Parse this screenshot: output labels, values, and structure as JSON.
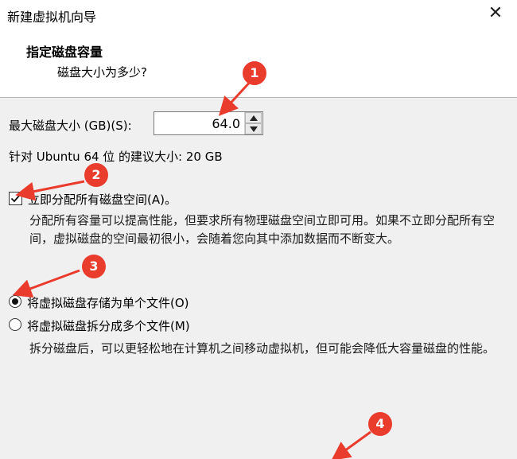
{
  "window": {
    "title": "新建虚拟机向导"
  },
  "header": {
    "title": "指定磁盘容量",
    "subtitle": "磁盘大小为多少?"
  },
  "disk_size": {
    "label": "最大磁盘大小 (GB)(S):",
    "value": "64.0",
    "recommend": "针对 Ubuntu 64 位 的建议大小: 20 GB"
  },
  "allocate": {
    "label": "立即分配所有磁盘空间(A)。",
    "checked": true,
    "description": "分配所有容量可以提高性能，但要求所有物理磁盘空间立即可用。如果不立即分配所有空间，虚拟磁盘的空间最初很小，会随着您向其中添加数据而不断变大。"
  },
  "storage": {
    "single_label": "将虚拟磁盘存储为单个文件(O)",
    "multi_label": "将虚拟磁盘拆分成多个文件(M)",
    "selected": "single",
    "description": "拆分磁盘后，可以更轻松地在计算机之间移动虚拟机，但可能会降低大容量磁盘的性能。"
  },
  "annotations": {
    "badges": [
      "1",
      "2",
      "3",
      "4"
    ],
    "color": "#ea3c2d"
  }
}
